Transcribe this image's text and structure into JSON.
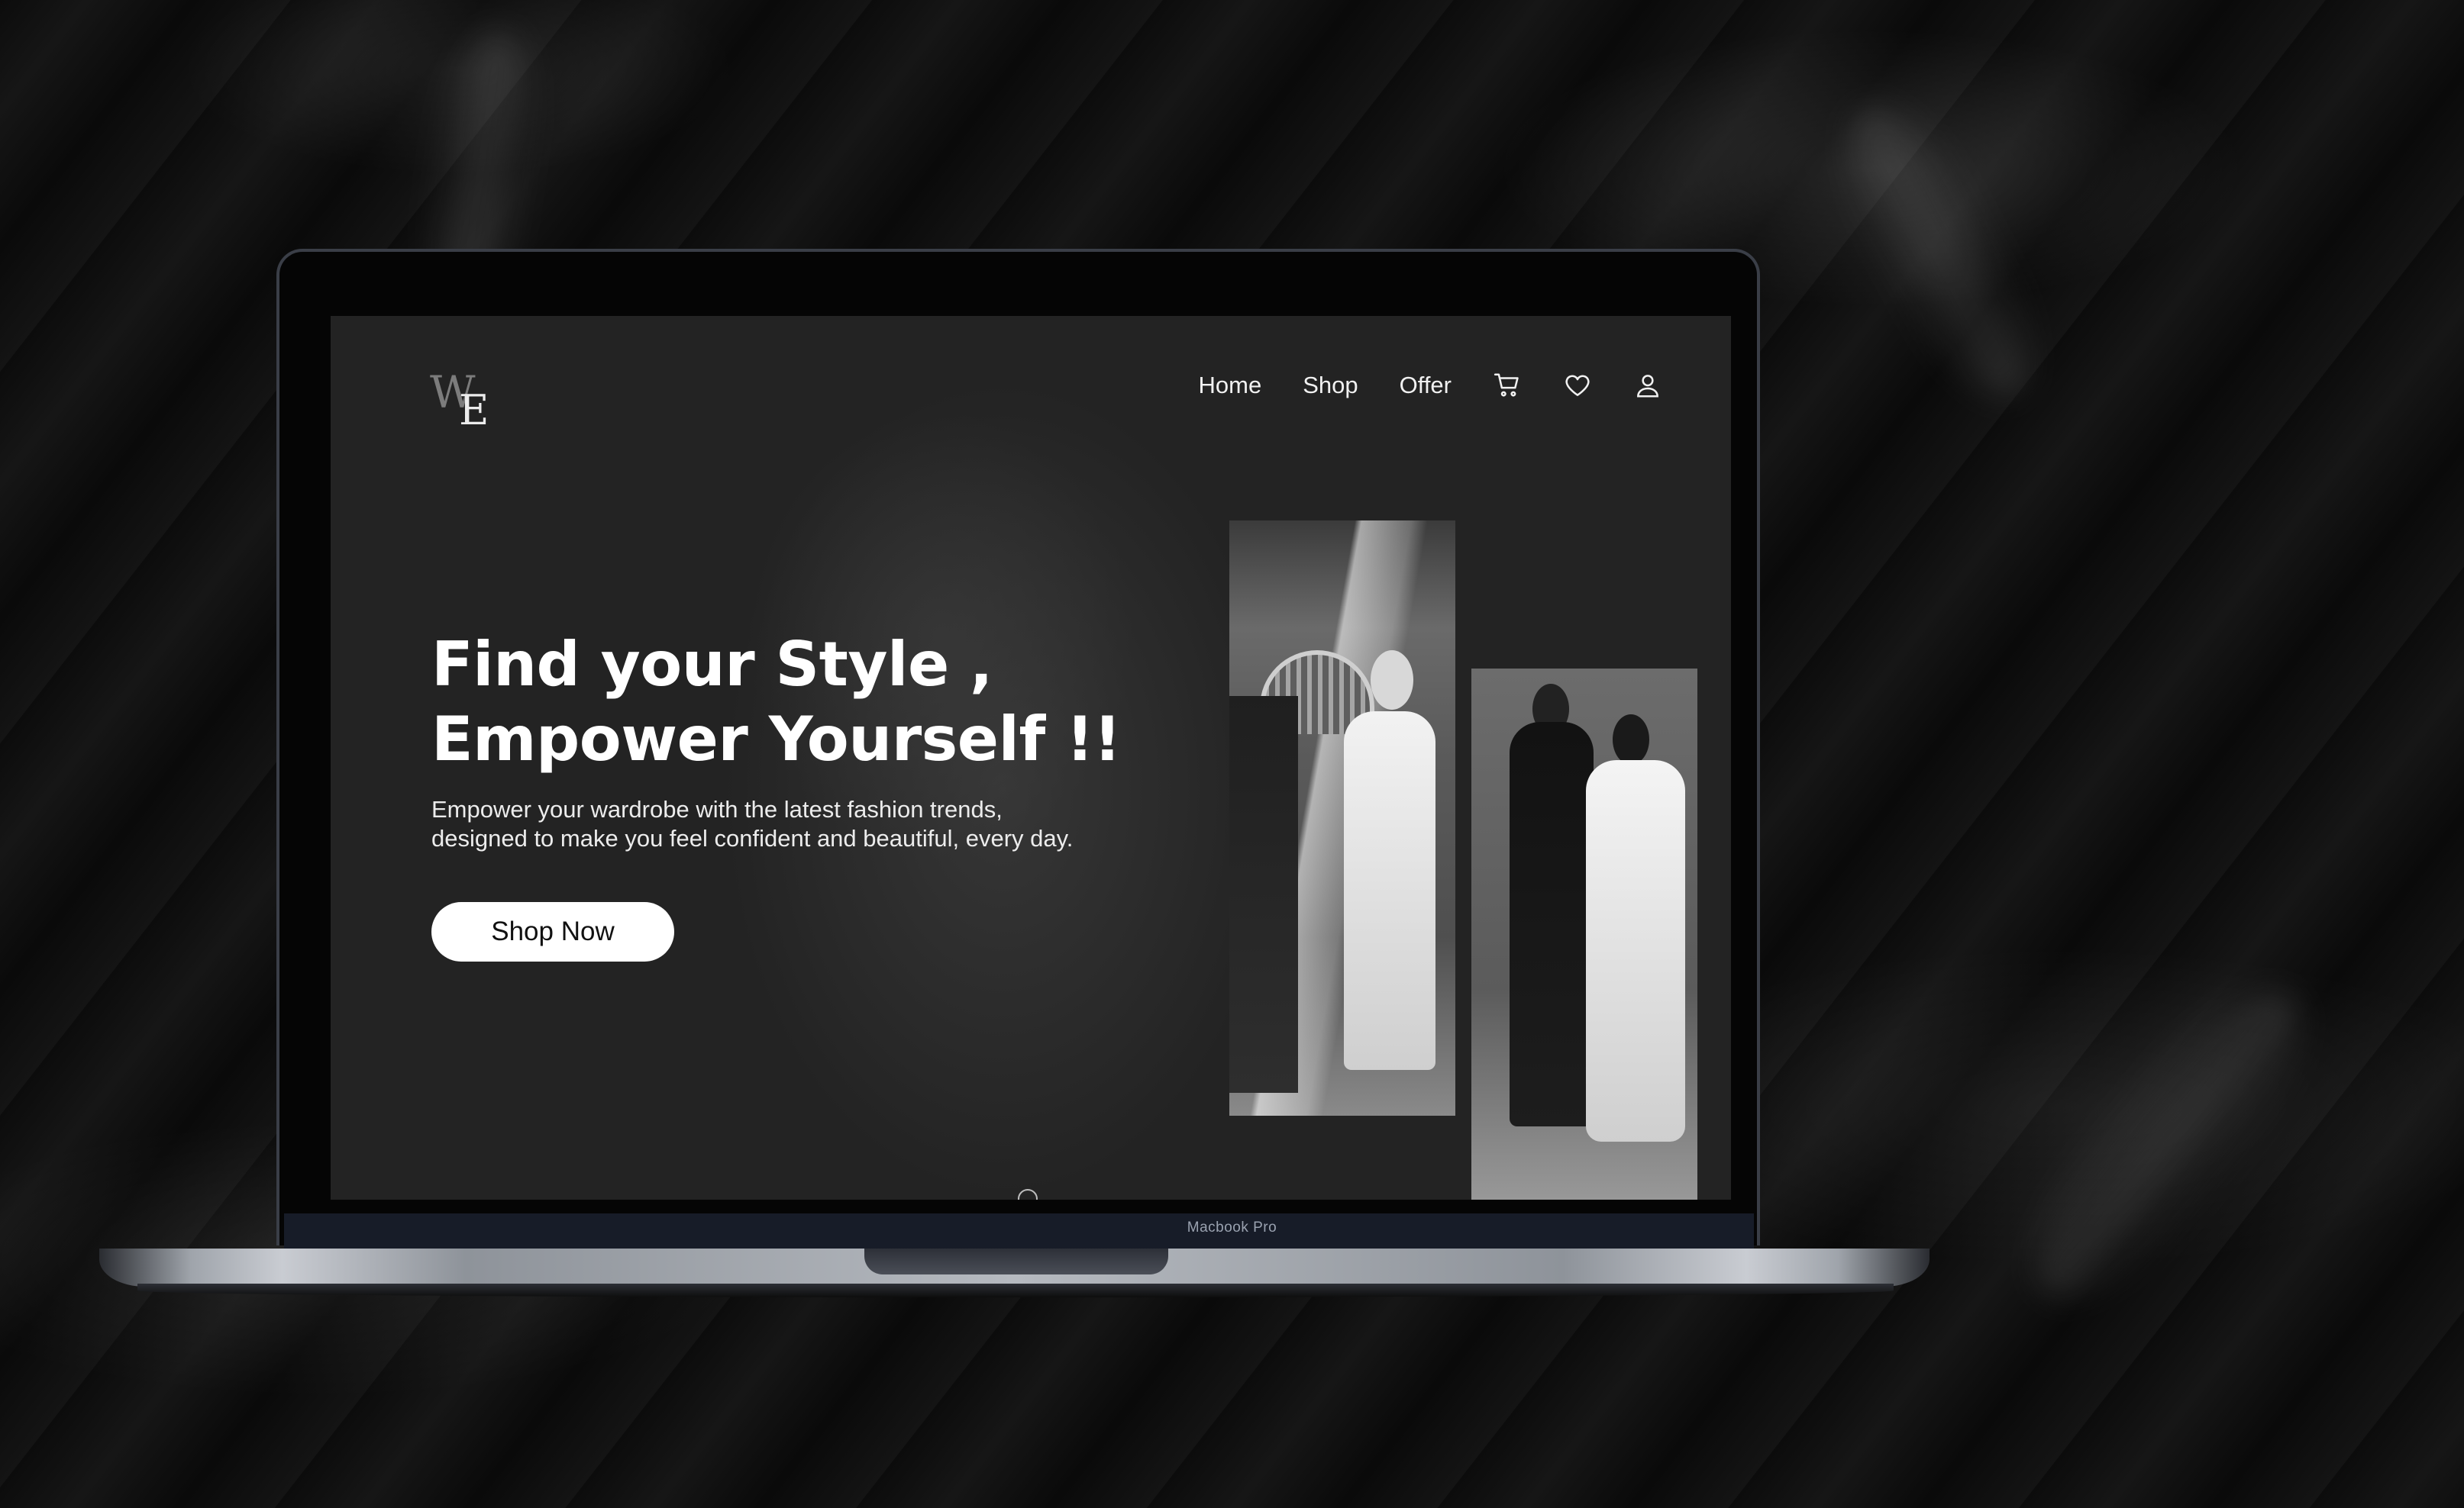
{
  "device": {
    "label": "Macbook Pro"
  },
  "brand": {
    "logo_top": "W",
    "logo_bottom": "E"
  },
  "nav": {
    "items": [
      {
        "label": "Home"
      },
      {
        "label": "Shop"
      },
      {
        "label": "Offer"
      }
    ],
    "icons": [
      "cart-icon",
      "heart-icon",
      "user-icon"
    ]
  },
  "hero": {
    "title_line1": "Find your Style ,",
    "title_line2": "Empower Yourself !!",
    "subtitle_line1": "Empower your wardrobe with the latest fashion trends,",
    "subtitle_line2": "designed to make you feel confident and beautiful, every day.",
    "cta_label": "Shop Now"
  },
  "colors": {
    "background": "#0d0d0d",
    "screen": "#232323",
    "text": "#ffffff",
    "button": "#ffffff"
  }
}
